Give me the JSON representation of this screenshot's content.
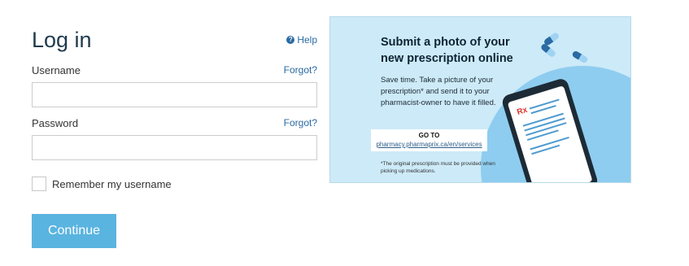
{
  "login": {
    "title": "Log in",
    "help_label": "Help",
    "username_label": "Username",
    "username_forgot": "Forgot?",
    "username_value": "",
    "password_label": "Password",
    "password_forgot": "Forgot?",
    "password_value": "",
    "remember_label": "Remember my username",
    "remember_checked": false,
    "continue_label": "Continue"
  },
  "promo": {
    "headline_line1": "Submit a photo of your",
    "headline_line2": "new prescription online",
    "body": "Save time. Take a picture of your prescription* and send it to your pharmacist-owner to have it filled.",
    "goto_label": "GO TO",
    "goto_link": "pharmacy.pharmaprix.ca/en/services",
    "footnote": "*The original prescription must be provided when picking up medications.",
    "rx_symbol": "Rx"
  },
  "colors": {
    "accent": "#5ab4e0",
    "link": "#2b6aa3",
    "promo_bg": "#cdeaf8",
    "title": "#1f3a4d"
  },
  "icons": {
    "help": "question-circle-icon",
    "promo_phone": "phone-icon",
    "promo_pills": "pill-icon"
  }
}
